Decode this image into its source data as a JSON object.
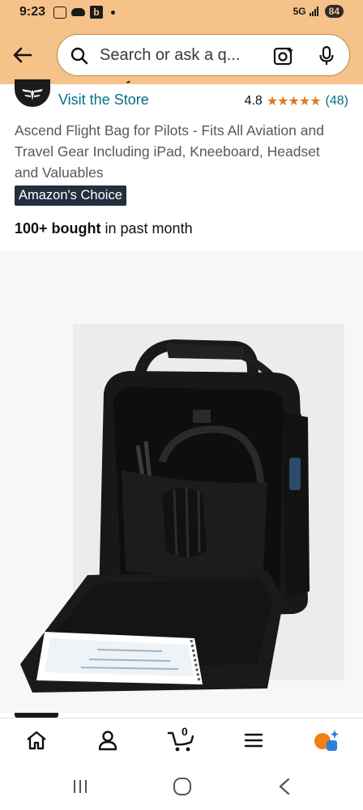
{
  "status_bar": {
    "time": "9:23",
    "network": "5G",
    "battery": "84"
  },
  "search": {
    "placeholder": "Search or ask a q..."
  },
  "brand": {
    "name_partial": "Wall-Worthy",
    "visit_label": "Visit the Store"
  },
  "rating": {
    "value": "4.8",
    "stars": "★★★★★",
    "count": "(48)"
  },
  "product": {
    "title": "Ascend Flight Bag for Pilots - Fits All Aviation and Travel Gear Including iPad, Kneeboard, Headset and Valuables",
    "badge": "Amazon's Choice",
    "bought_bold": "100+ bought",
    "bought_rest": " in past month"
  },
  "bottom_nav": {
    "cart_count": "0",
    "items": [
      "home-icon",
      "account-icon",
      "cart-icon",
      "menu-icon",
      "rufus-icon"
    ]
  },
  "system_nav": [
    "recent-apps-icon",
    "home-circle-icon",
    "back-chevron-icon"
  ],
  "colors": {
    "header_bg": "#f5c28a",
    "link": "#007185",
    "stars": "#de7921",
    "badge_bg": "#232f3e"
  }
}
